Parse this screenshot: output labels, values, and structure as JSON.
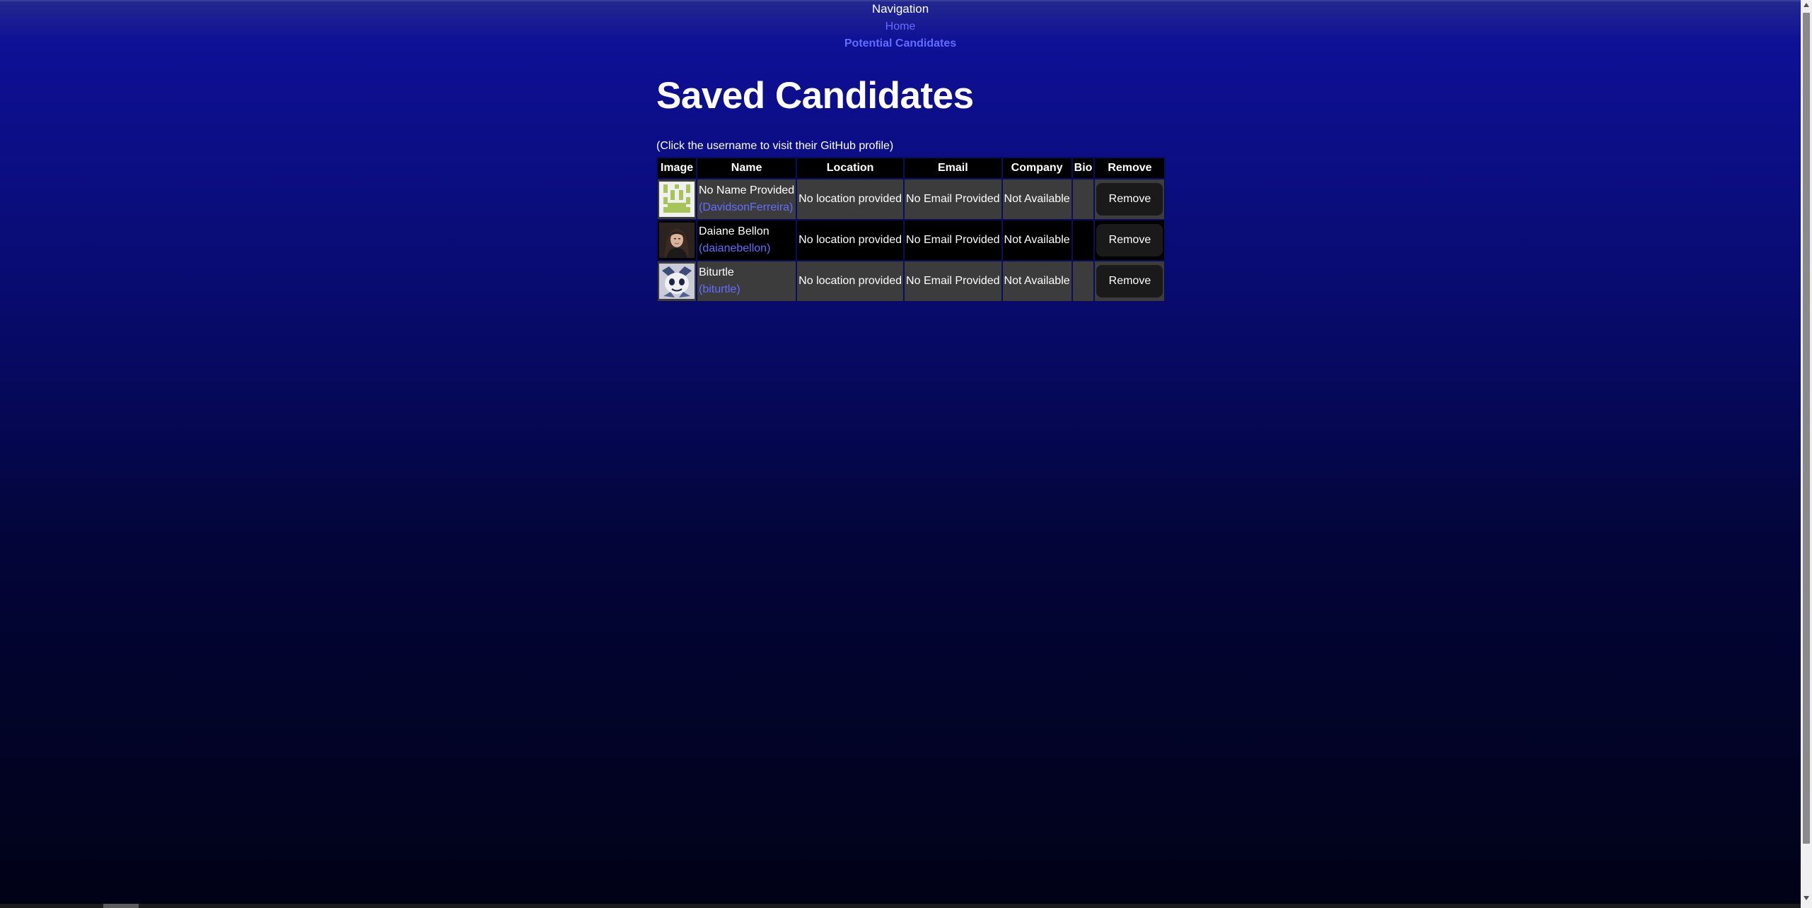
{
  "nav": {
    "title": "Navigation",
    "links": [
      {
        "label": "Home",
        "active": false
      },
      {
        "label": "Potential Candidates",
        "active": true
      }
    ]
  },
  "page": {
    "title": "Saved Candidates",
    "hint": "(Click the username to visit their GitHub profile)"
  },
  "table": {
    "headers": [
      "Image",
      "Name",
      "Location",
      "Email",
      "Company",
      "Bio",
      "Remove"
    ],
    "rows": [
      {
        "name": "No Name Provided",
        "username": "(DavidsonFerreira)",
        "location": "No location provided",
        "email": "No Email Provided",
        "company": "Not Available",
        "bio": "",
        "remove_label": "Remove",
        "avatar": "green-pixel-identicon"
      },
      {
        "name": "Daiane Bellon",
        "username": "(daianebellon)",
        "location": "No location provided",
        "email": "No Email Provided",
        "company": "Not Available",
        "bio": "",
        "remove_label": "Remove",
        "avatar": "portrait-photo"
      },
      {
        "name": "Biturtle",
        "username": "(biturtle)",
        "location": "No location provided",
        "email": "No Email Provided",
        "company": "Not Available",
        "bio": "",
        "remove_label": "Remove",
        "avatar": "cartoon-avatar"
      }
    ]
  },
  "colors": {
    "link": "#646cff",
    "row_odd": "#3c3c3c",
    "row_even": "#000000",
    "header_bg": "#000000",
    "button_bg": "#1a1a1a"
  }
}
